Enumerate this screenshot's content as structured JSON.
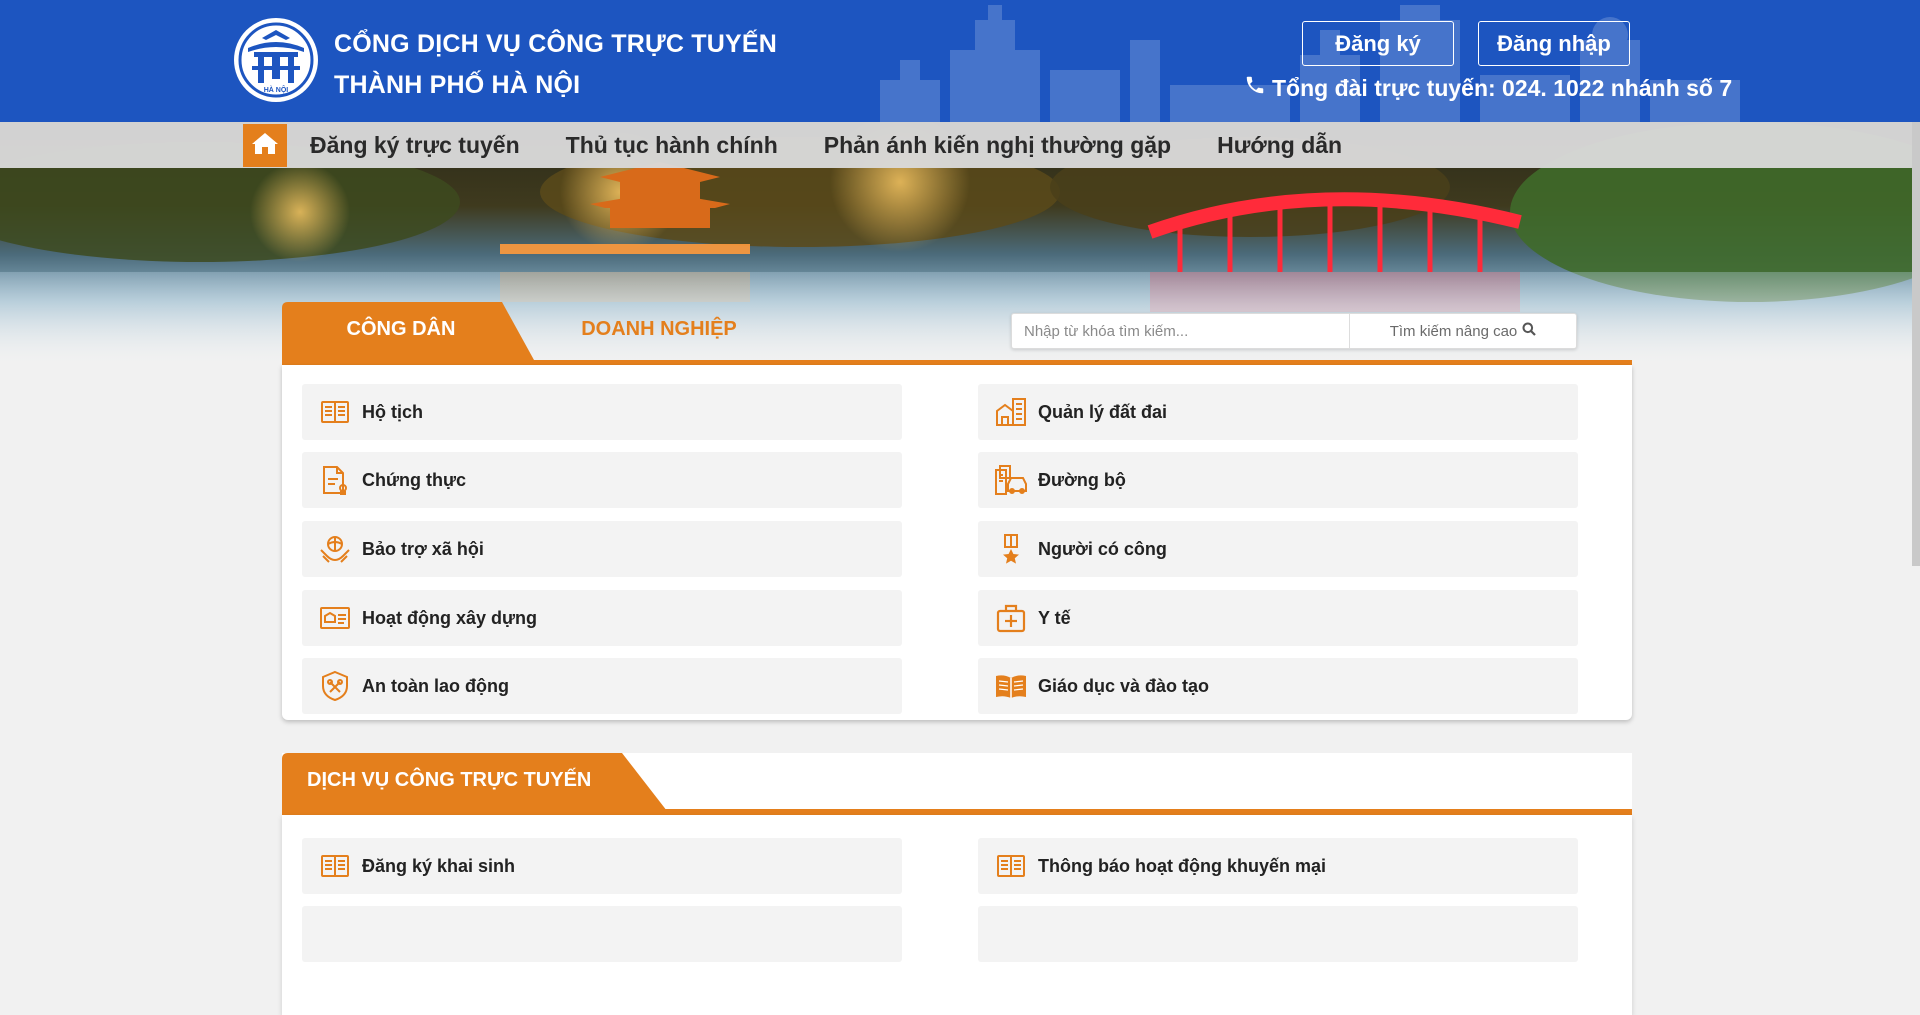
{
  "header": {
    "title_line1": "CỔNG DỊCH VỤ CÔNG TRỰC TUYẾN",
    "title_line2": "THÀNH PHỐ HÀ NỘI",
    "register_label": "Đăng ký",
    "login_label": "Đăng nhập",
    "hotline": "Tổng đài trực tuyến: 024. 1022 nhánh số 7",
    "logo_text": "HÀ NỘI"
  },
  "nav": {
    "home_icon": "home-icon",
    "items": [
      {
        "label": "Đăng ký trực tuyến"
      },
      {
        "label": "Thủ tục hành chính"
      },
      {
        "label": "Phản ánh kiến nghị thường gặp"
      },
      {
        "label": "Hướng dẫn"
      }
    ]
  },
  "search_panel": {
    "tabs": [
      {
        "label": "CÔNG DÂN",
        "active": true
      },
      {
        "label": "DOANH NGHIỆP",
        "active": false
      }
    ],
    "search_placeholder": "Nhập từ khóa tìm kiếm...",
    "advanced_search_label": "Tìm kiếm nâng cao",
    "categories": [
      {
        "label": "Hộ tịch",
        "icon": "book-icon"
      },
      {
        "label": "Quản lý đất đai",
        "icon": "buildings-icon"
      },
      {
        "label": "Chứng thực",
        "icon": "document-icon"
      },
      {
        "label": "Đường bộ",
        "icon": "car-building-icon"
      },
      {
        "label": "Bảo trợ xã hội",
        "icon": "hands-globe-icon"
      },
      {
        "label": "Người có công",
        "icon": "medal-icon"
      },
      {
        "label": "Hoạt động xây dựng",
        "icon": "id-card-icon"
      },
      {
        "label": "Y tế",
        "icon": "medical-kit-icon"
      },
      {
        "label": "An toàn lao động",
        "icon": "safety-shield-icon"
      },
      {
        "label": "Giáo dục và đào tạo",
        "icon": "open-book-icon"
      }
    ]
  },
  "online_services": {
    "title": "DỊCH VỤ CÔNG TRỰC TUYẾN",
    "items": [
      {
        "label": "Đăng ký khai sinh",
        "icon": "book-icon"
      },
      {
        "label": "Thông báo hoạt động khuyến mại",
        "icon": "book-icon"
      }
    ]
  },
  "colors": {
    "header_blue": "#1d55c0",
    "accent_orange": "#e47f1c",
    "nav_gray": "#dadada",
    "page_bg": "#f1f1f1"
  }
}
